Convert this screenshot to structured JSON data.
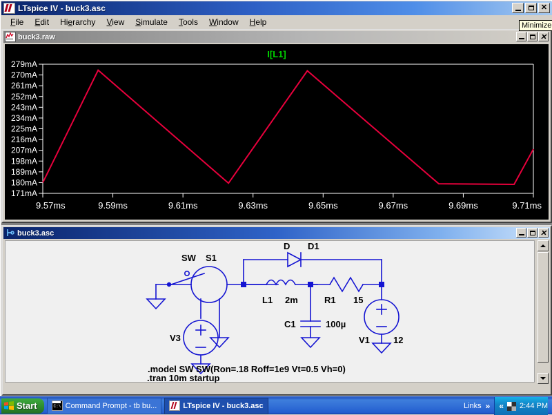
{
  "app": {
    "title": "LTspice IV - buck3.asc",
    "menu": [
      "File",
      "Edit",
      "Hierarchy",
      "View",
      "Simulate",
      "Tools",
      "Window",
      "Help"
    ],
    "tooltip": "Minimize",
    "window_buttons": {
      "minimize": "_",
      "maximize": "□",
      "close": "×"
    }
  },
  "wave_window": {
    "title": "buck3.raw",
    "icon": "waveform-icon",
    "buttons": {
      "minimize": "_",
      "maximize": "□",
      "close": "×"
    }
  },
  "schematic_window": {
    "title": "buck3.asc",
    "icon": "schematic-icon",
    "buttons": {
      "minimize": "_",
      "maximize": "□",
      "close": "×"
    },
    "components": [
      {
        "name": "S1",
        "type": "switch",
        "model": "SW",
        "label_model": "SW",
        "label_ref": "S1"
      },
      {
        "name": "V3",
        "type": "voltage-source",
        "label_ref": "V3",
        "value": ""
      },
      {
        "name": "D1",
        "type": "diode",
        "label_model": "D",
        "label_ref": "D1"
      },
      {
        "name": "L1",
        "type": "inductor",
        "label_ref": "L1",
        "value": "2m"
      },
      {
        "name": "C1",
        "type": "capacitor",
        "label_ref": "C1",
        "value": "100µ"
      },
      {
        "name": "R1",
        "type": "resistor",
        "label_ref": "R1",
        "value": "15"
      },
      {
        "name": "V1",
        "type": "voltage-source",
        "label_ref": "V1",
        "value": "12"
      }
    ],
    "directives": [
      ".model SW SW(Ron=.18 Roff=1e9 Vt=0.5 Vh=0)",
      ".tran 10m startup"
    ],
    "colors": {
      "wire": "#1414d2",
      "background": "#f0f0f0",
      "text": "#000000"
    }
  },
  "chart_data": {
    "type": "line",
    "title": "I[L1]",
    "trace_name": "I[L1]",
    "trace_color": "#e8003c",
    "label_color": "#00d000",
    "background": "#000000",
    "grid": true,
    "grid_color": "#ffffff",
    "xlabel": "",
    "ylabel": "",
    "xunit": "ms",
    "yunit": "mA",
    "xlim": [
      9.57,
      9.71
    ],
    "ylim": [
      171,
      279
    ],
    "xticks": [
      "9.57ms",
      "9.59ms",
      "9.61ms",
      "9.63ms",
      "9.65ms",
      "9.67ms",
      "9.69ms",
      "9.71ms"
    ],
    "xtick_values": [
      9.57,
      9.59,
      9.61,
      9.63,
      9.65,
      9.67,
      9.69,
      9.71
    ],
    "yticks": [
      "279mA",
      "270mA",
      "261mA",
      "252mA",
      "243mA",
      "234mA",
      "225mA",
      "216mA",
      "207mA",
      "198mA",
      "189mA",
      "180mA",
      "171mA"
    ],
    "ytick_values": [
      279,
      270,
      261,
      252,
      243,
      234,
      225,
      216,
      207,
      198,
      189,
      180,
      171
    ],
    "series": [
      {
        "name": "I[L1]",
        "x": [
          9.57,
          9.5858,
          9.623,
          9.6455,
          9.683,
          9.7045,
          9.71
        ],
        "y": [
          180.0,
          274.0,
          179.5,
          273.5,
          179.0,
          178.5,
          208.0
        ]
      }
    ]
  },
  "taskbar": {
    "start": "Start",
    "items": [
      {
        "label": "Command Prompt - tb bu...",
        "icon": "console-icon",
        "selected": false
      },
      {
        "label": "LTspice IV - buck3.asc",
        "icon": "ltspice-icon",
        "selected": true
      }
    ],
    "links_label": "Links",
    "links_chevron": "»",
    "tray_chevron": "«",
    "clock": "2:44 PM"
  }
}
